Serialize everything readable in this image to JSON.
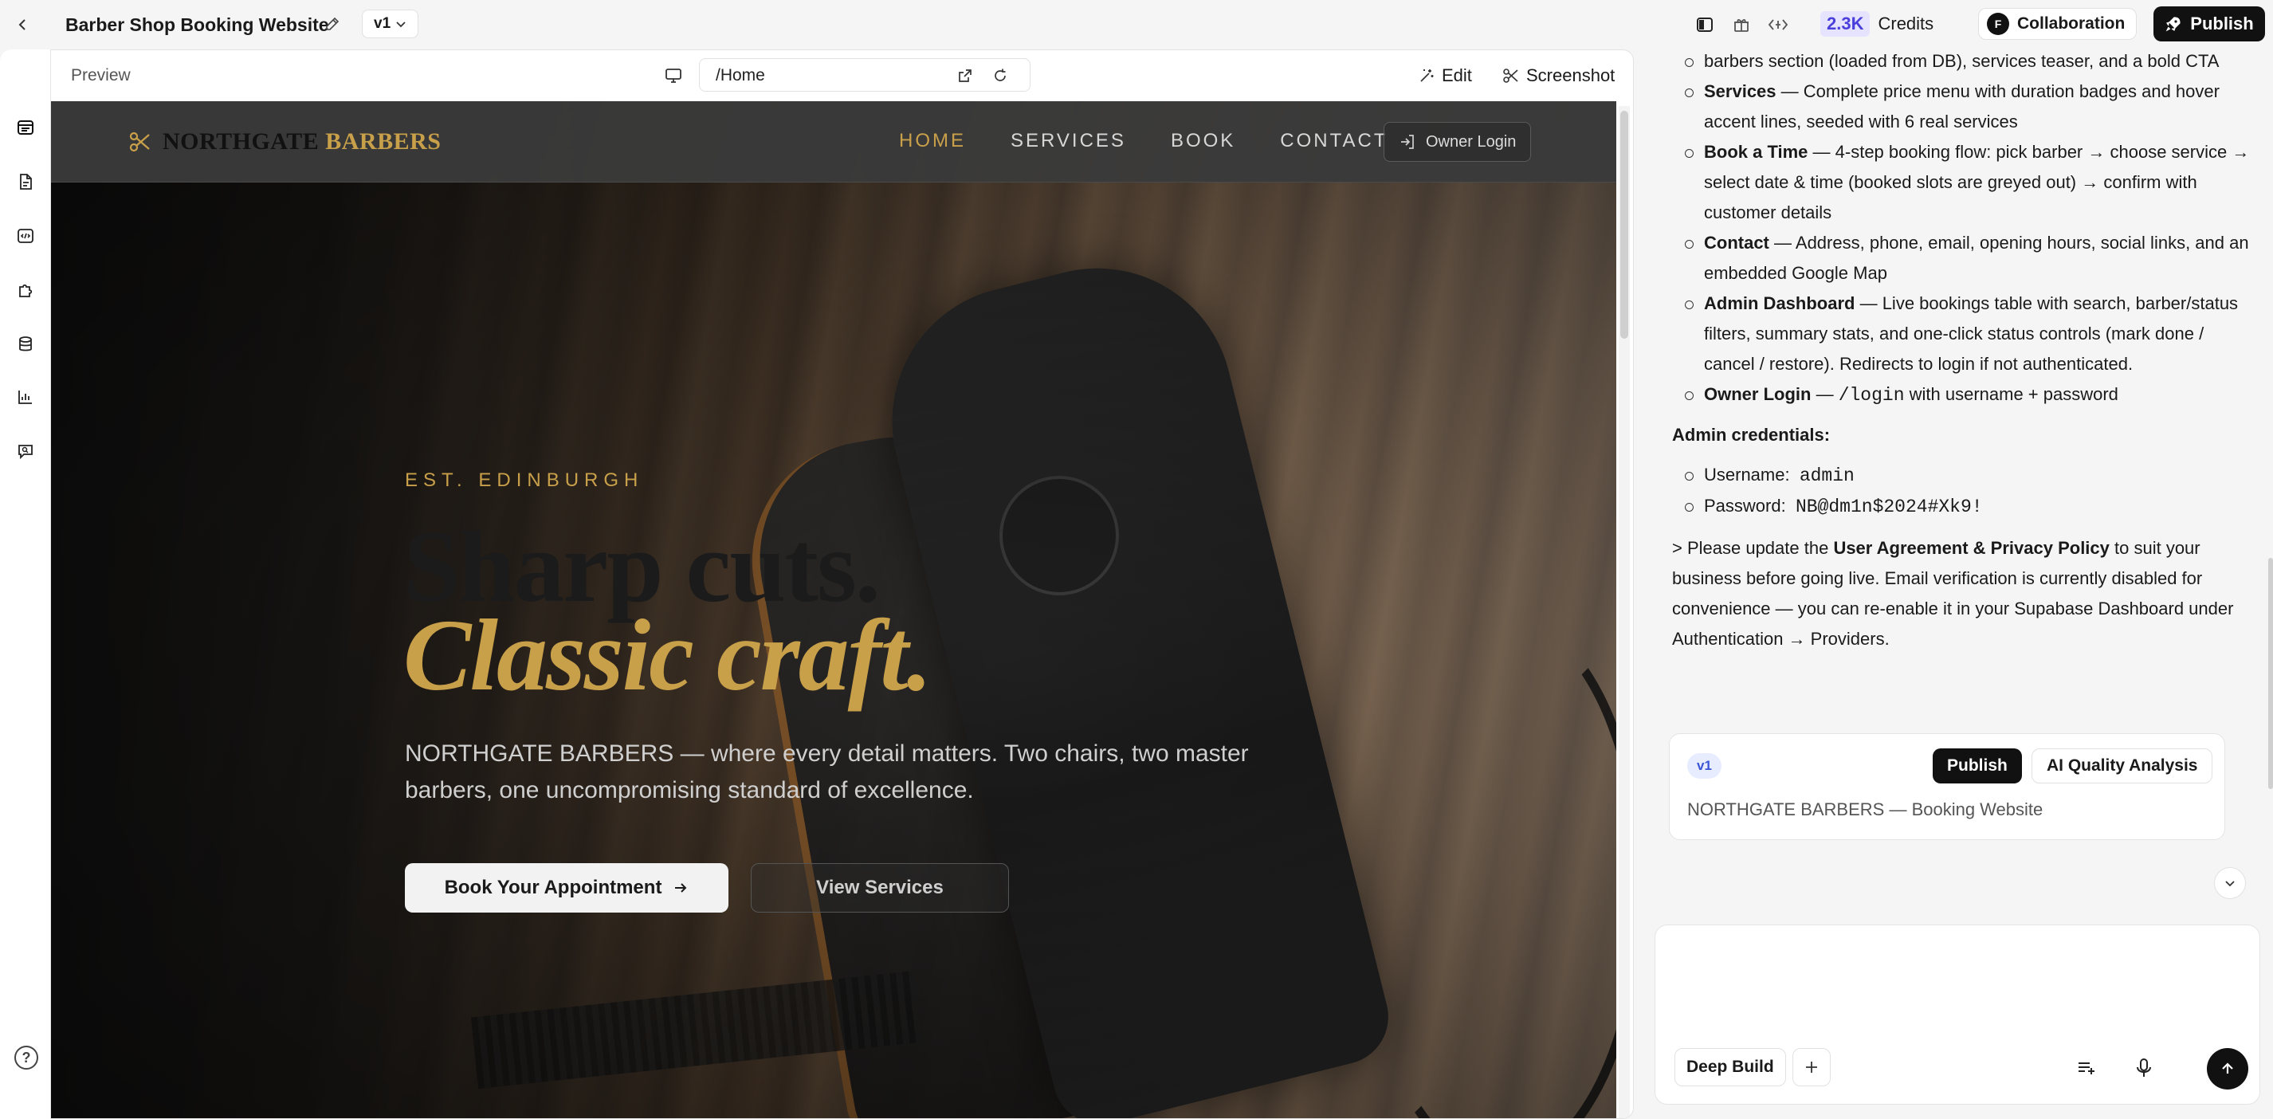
{
  "topbar": {
    "project_title": "Barber Shop Booking Website",
    "version": "v1",
    "credits_value": "2.3K",
    "credits_label": "Credits",
    "collab_initial": "F",
    "collab_label": "Collaboration",
    "publish_label": "Publish"
  },
  "preview": {
    "label": "Preview",
    "url": "/Home",
    "edit_label": "Edit",
    "screenshot_label": "Screenshot"
  },
  "site": {
    "brand_part1": "NORTHGATE",
    "brand_part2": "BARBERS",
    "nav": [
      "HOME",
      "SERVICES",
      "BOOK",
      "CONTACT"
    ],
    "owner_login": "Owner Login",
    "eyebrow": "EST. EDINBURGH",
    "headline_1": "Sharp cuts.",
    "headline_2": "Classic craft.",
    "description": "NORTHGATE BARBERS — where every detail matters. Two chairs, two master barbers, one uncompromising standard of excellence.",
    "cta_primary": "Book Your Appointment",
    "cta_secondary": "View Services",
    "accent_color": "#c9a04a"
  },
  "chat": {
    "intro_cont": "barbers section (loaded from DB), services teaser, and a bold CTA",
    "items": [
      {
        "title": "Services",
        "text": " — Complete price menu with duration badges and hover accent lines, seeded with 6 real services"
      },
      {
        "title": "Book a Time",
        "text": " — 4-step booking flow: pick barber → choose service → select date & time (booked slots are greyed out) → confirm with customer details"
      },
      {
        "title": "Contact",
        "text": " — Address, phone, email, opening hours, social links, and an embedded Google Map"
      },
      {
        "title": "Admin Dashboard",
        "text": " — Live bookings table with search, barber/status filters, summary stats, and one-click status controls (mark done / cancel / restore). Redirects to login if not authenticated."
      },
      {
        "title": "Owner Login",
        "text_pre": " — ",
        "code": "/login",
        "text_post": " with username + password"
      }
    ],
    "credentials_heading": "Admin credentials:",
    "username_label": "Username:",
    "username_value": "admin",
    "password_label": "Password:",
    "password_value": "NB@dm1n$2024#Xk9!",
    "note_pre": "> Please update the ",
    "note_bold": "User Agreement & Privacy Policy",
    "note_post": " to suit your business before going live. Email verification is currently disabled for convenience — you can re-enable it in your Supabase Dashboard under Authentication → Providers.",
    "card": {
      "version": "v1",
      "publish": "Publish",
      "ai_analysis": "AI Quality Analysis",
      "subtitle": "NORTHGATE BARBERS — Booking Website"
    },
    "input": {
      "deep_build": "Deep Build"
    }
  },
  "icons": [
    "back-arrow-icon",
    "pencil-icon",
    "chevron-down-icon",
    "panel-toggle-icon",
    "gift-icon",
    "code-diff-icon",
    "rocket-icon",
    "monitor-icon",
    "external-link-icon",
    "reload-icon",
    "sparkle-edit-icon",
    "scissors-icon",
    "login-icon",
    "arrow-right-icon",
    "help-icon",
    "send-arrow-icon",
    "microphone-icon",
    "queue-icon",
    "plus-icon"
  ]
}
